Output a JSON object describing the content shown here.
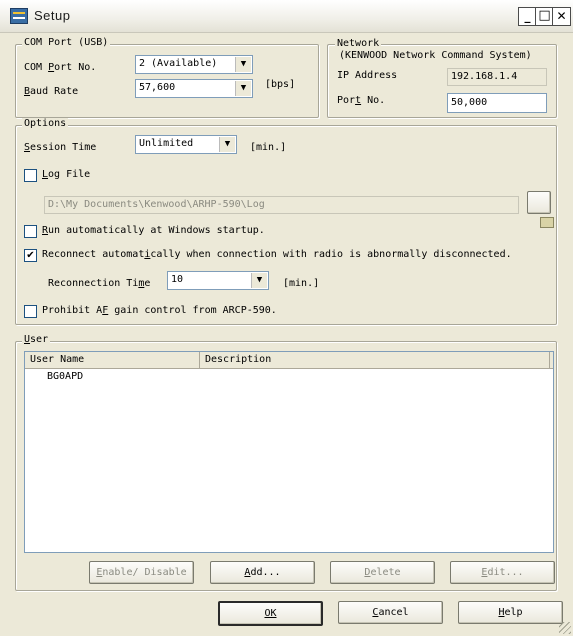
{
  "window": {
    "title": "Setup",
    "min_glyph": "_",
    "max_glyph": "□",
    "close_glyph": "✕"
  },
  "com_port": {
    "group_label": "COM Port (USB)",
    "port_label_pre": "COM ",
    "port_label_u": "P",
    "port_label_post": "ort No.",
    "port_value": "2 (Available)",
    "baud_label_u": "B",
    "baud_label_post": "aud Rate",
    "baud_value": "57,600",
    "baud_unit": "[bps]"
  },
  "network": {
    "group_label": "Network",
    "subtitle": "(KENWOOD Network Command System)",
    "ip_label": "IP Address",
    "ip_value": "192.168.1.4",
    "port_label_pre": "Por",
    "port_label_u": "t",
    "port_label_post": " No.",
    "port_value": "50,000"
  },
  "options": {
    "group_label": "Options",
    "session_label_u": "S",
    "session_label_post": "ession Time",
    "session_value": "Unlimited",
    "session_unit": "[min.]",
    "log_file_label_u": "L",
    "log_file_label_post": "og File",
    "log_file_checked": false,
    "log_path": "D:\\My Documents\\Kenwood\\ARHP-590\\Log",
    "run_label_u": "R",
    "run_label_post": "un automatically at Windows startup.",
    "run_checked": false,
    "reconnect_label_pre": "Reconnect automat",
    "reconnect_label_u": "i",
    "reconnect_label_post": "cally when connection with radio is abnormally disconnected.",
    "reconnect_checked": true,
    "reconnect_time_label_pre": "Reconnection Ti",
    "reconnect_time_label_u": "m",
    "reconnect_time_label_post": "e",
    "reconnect_time_value": "10",
    "reconnect_time_unit": "[min.]",
    "prohibit_label_pre": "Prohibit A",
    "prohibit_label_u": "F",
    "prohibit_label_post": " gain control from ARCP-590.",
    "prohibit_checked": false
  },
  "user": {
    "group_label_u": "U",
    "group_label_post": "ser",
    "columns": [
      "User Name",
      "Description"
    ],
    "rows": [
      {
        "name": "BG0APD",
        "description": ""
      }
    ],
    "enable_btn_u": "E",
    "enable_btn_post": "nable/ Disable",
    "add_btn_u": "A",
    "add_btn_post": "dd...",
    "delete_btn_u": "D",
    "delete_btn_post": "elete",
    "edit_btn_u": "E",
    "edit_btn_post": "dit..."
  },
  "footer": {
    "ok": "OK",
    "cancel_u": "C",
    "cancel_post": "ancel",
    "help_u": "H",
    "help_post": "elp"
  },
  "checkmark": "✔",
  "colors": {
    "window_bg": "#ece9d8",
    "field_border": "#7f9db9"
  }
}
